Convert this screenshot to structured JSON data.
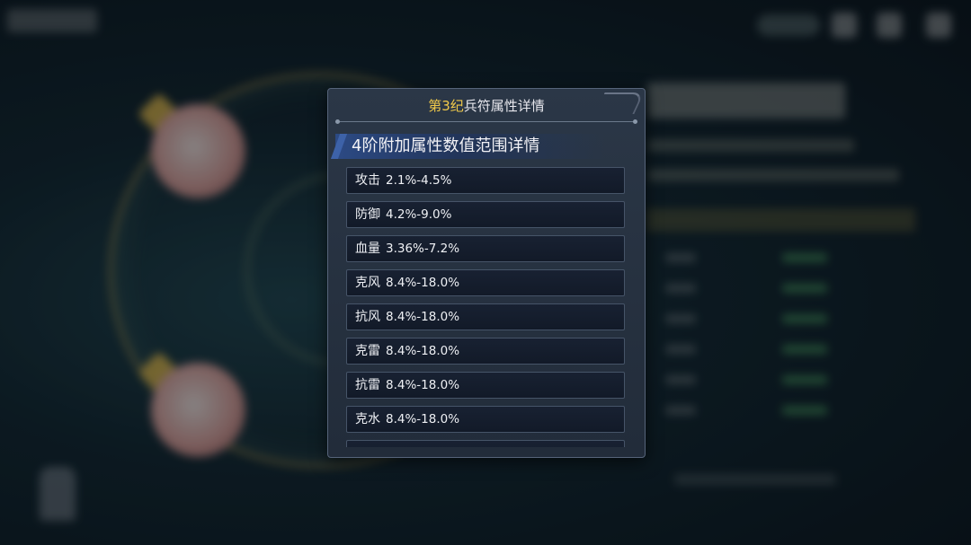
{
  "dialog": {
    "title_highlight": "第3纪",
    "title_rest": "兵符属性详情",
    "section_title": "4阶附加属性数值范围详情",
    "attributes": [
      {
        "name": "攻击",
        "range": "2.1%-4.5%"
      },
      {
        "name": "防御",
        "range": "4.2%-9.0%"
      },
      {
        "name": "血量",
        "range": "3.36%-7.2%"
      },
      {
        "name": "克风",
        "range": "8.4%-18.0%"
      },
      {
        "name": "抗风",
        "range": "8.4%-18.0%"
      },
      {
        "name": "克雷",
        "range": "8.4%-18.0%"
      },
      {
        "name": "抗雷",
        "range": "8.4%-18.0%"
      },
      {
        "name": "克水",
        "range": "8.4%-18.0%"
      },
      {
        "name": "",
        "range": ""
      }
    ]
  },
  "colors": {
    "title_highlight": "#f0c94a",
    "panel_bg": "#27313f",
    "section_accent": "#2c4a84"
  }
}
